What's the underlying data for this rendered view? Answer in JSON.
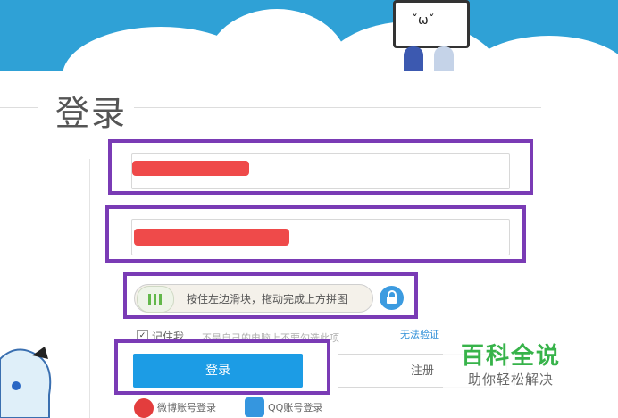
{
  "page": {
    "title": "登录"
  },
  "colors": {
    "accent": "#1c9ce5",
    "highlight": "#7a3bb5",
    "redaction": "#ef4a4a",
    "watermark": "#37b34a"
  },
  "form": {
    "username_value": "",
    "password_value": "",
    "slider_text": "按住左边滑块，拖动完成上方拼图",
    "remember_label": "记住我",
    "remember_hint": "不是自己的电脑上不要勾选此项",
    "cant_verify": "无法验证",
    "login_label": "登录",
    "register_label": "注册",
    "weibo_login": "微博账号登录",
    "qq_login": "QQ账号登录"
  },
  "watermark": {
    "title": "百科全说",
    "subtitle": "助你轻松解决"
  },
  "icons": [
    "lock-icon",
    "weibo-icon",
    "qq-icon",
    "slider-handle-icon"
  ]
}
